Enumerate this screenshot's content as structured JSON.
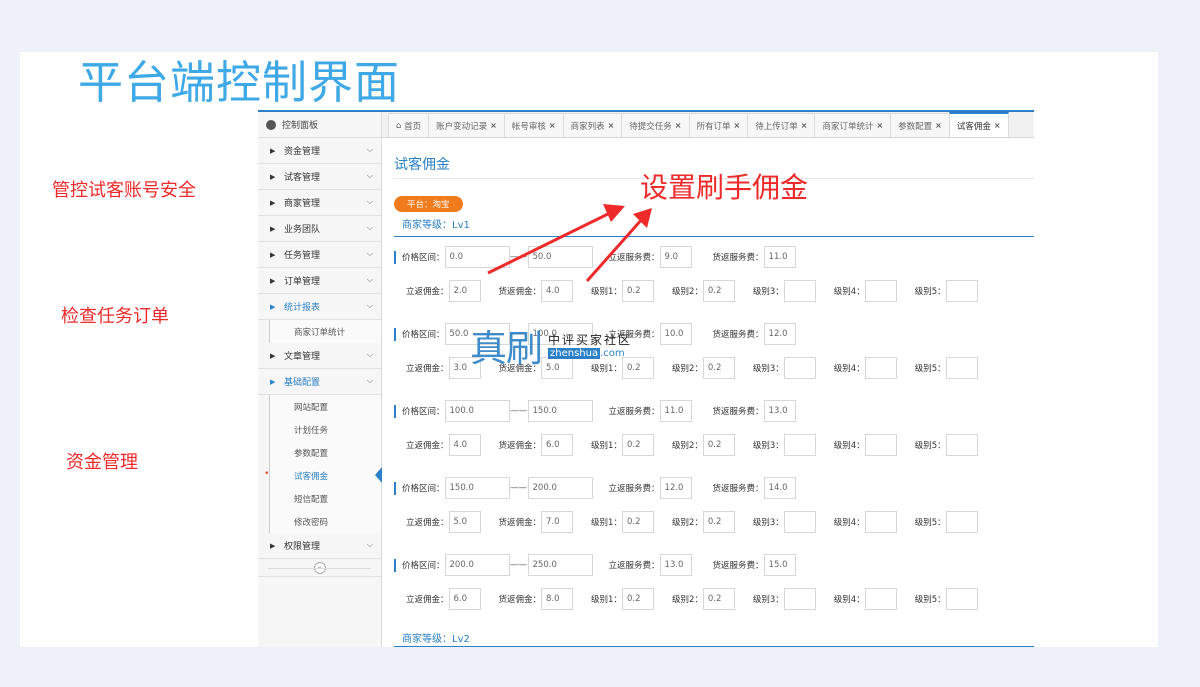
{
  "slide_title": "平台端控制界面",
  "annotations": {
    "note1": "管控试客账号安全",
    "note2": "检查任务订单",
    "note3": "资金管理",
    "callout": "设置刷手佣金"
  },
  "sidebar": {
    "header": "控制面板",
    "items": [
      {
        "label": "资金管理"
      },
      {
        "label": "试客管理"
      },
      {
        "label": "商家管理"
      },
      {
        "label": "业务团队"
      },
      {
        "label": "任务管理"
      },
      {
        "label": "订单管理"
      },
      {
        "label": "统计报表"
      },
      {
        "label": "商家订单统计"
      },
      {
        "label": "文章管理"
      },
      {
        "label": "基础配置"
      },
      {
        "label": "网站配置"
      },
      {
        "label": "计划任务"
      },
      {
        "label": "参数配置"
      },
      {
        "label": "试客佣金"
      },
      {
        "label": "短信配置"
      },
      {
        "label": "修改密码"
      },
      {
        "label": "权限管理"
      }
    ]
  },
  "tabs": [
    {
      "label": "首页"
    },
    {
      "label": "账户变动记录"
    },
    {
      "label": "帐号审核"
    },
    {
      "label": "商家列表"
    },
    {
      "label": "待提交任务"
    },
    {
      "label": "所有订单"
    },
    {
      "label": "待上传订单"
    },
    {
      "label": "商家订单统计"
    },
    {
      "label": "参数配置"
    },
    {
      "label": "试客佣金"
    }
  ],
  "page": {
    "title": "试客佣金",
    "platform_badge": "平台：淘宝",
    "level1": "商家等级：Lv1",
    "level2": "商家等级：Lv2",
    "labels": {
      "price_range": "价格区间：",
      "dash": "——",
      "li_fan_fee": "立返服务费：",
      "huo_fan_fee": "货返服务费：",
      "li_fan_comm": "立返佣金：",
      "huo_fan_comm": "货返佣金：",
      "lv1": "级别1：",
      "lv2": "级别2：",
      "lv3": "级别3：",
      "lv4": "级别4：",
      "lv5": "级别5："
    },
    "tiers": [
      {
        "min": "0.0",
        "max": "50.0",
        "li_fee": "9.0",
        "huo_fee": "11.0",
        "li_comm": "2.0",
        "huo_comm": "4.0",
        "l1": "0.2",
        "l2": "0.2",
        "l3": "",
        "l4": "",
        "l5": ""
      },
      {
        "min": "50.0",
        "max": "100.0",
        "li_fee": "10.0",
        "huo_fee": "12.0",
        "li_comm": "3.0",
        "huo_comm": "5.0",
        "l1": "0.2",
        "l2": "0.2",
        "l3": "",
        "l4": "",
        "l5": ""
      },
      {
        "min": "100.0",
        "max": "150.0",
        "li_fee": "11.0",
        "huo_fee": "13.0",
        "li_comm": "4.0",
        "huo_comm": "6.0",
        "l1": "0.2",
        "l2": "0.2",
        "l3": "",
        "l4": "",
        "l5": ""
      },
      {
        "min": "150.0",
        "max": "200.0",
        "li_fee": "12.0",
        "huo_fee": "14.0",
        "li_comm": "5.0",
        "huo_comm": "7.0",
        "l1": "0.2",
        "l2": "0.2",
        "l3": "",
        "l4": "",
        "l5": ""
      },
      {
        "min": "200.0",
        "max": "250.0",
        "li_fee": "13.0",
        "huo_fee": "15.0",
        "li_comm": "6.0",
        "huo_comm": "8.0",
        "l1": "0.2",
        "l2": "0.2",
        "l3": "",
        "l4": "",
        "l5": ""
      }
    ]
  },
  "watermark": {
    "big": "真刷",
    "cn": "中评买家社区",
    "url_brand": "zhenshua",
    "url_tld": ".com"
  },
  "colors": {
    "accent": "#2b80c7",
    "title": "#3fa8e6",
    "annotation": "#ee2a2a",
    "badge": "#f07b1c"
  }
}
